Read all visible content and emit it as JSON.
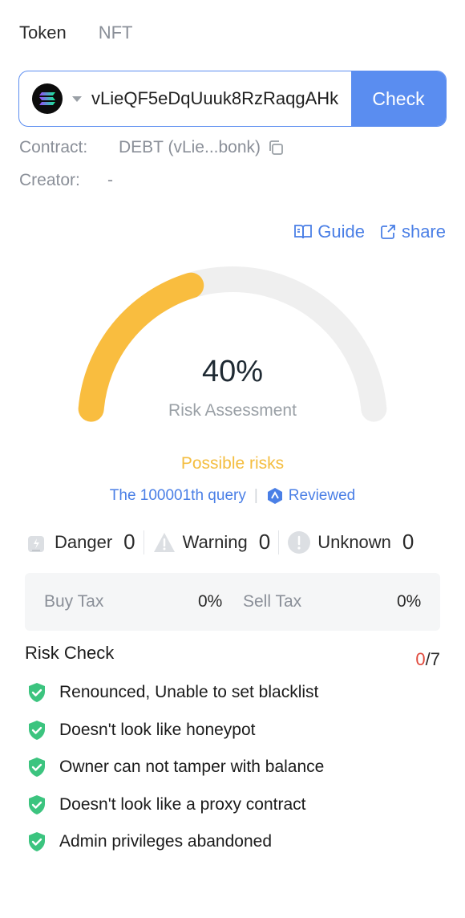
{
  "tabs": [
    {
      "label": "Token",
      "active": true
    },
    {
      "label": "NFT",
      "active": false
    }
  ],
  "search": {
    "chain_icon": "solana-logo",
    "address": "vLieQF5eDqUuuk8RzRaqgAHk",
    "check_label": "Check"
  },
  "contract": {
    "label": "Contract:",
    "value": "DEBT (vLie...bonk)",
    "copy_icon": "copy-icon"
  },
  "creator": {
    "label": "Creator:",
    "value": "-"
  },
  "links": {
    "guide": "Guide",
    "share": "share"
  },
  "gauge": {
    "percent_text": "40%",
    "fraction": 0.4,
    "label": "Risk Assessment",
    "status": "Possible risks",
    "fill_color": "#f9bd3f",
    "track_color": "#efefef"
  },
  "query": {
    "text": "The 100001th query",
    "reviewed": "Reviewed"
  },
  "stats": {
    "danger_label": "Danger",
    "danger_count": "0",
    "warning_label": "Warning",
    "warning_count": "0",
    "unknown_label": "Unknown",
    "unknown_count": "0"
  },
  "tax": {
    "buy_label": "Buy Tax",
    "buy_value": "0%",
    "sell_label": "Sell Tax",
    "sell_value": "0%"
  },
  "risk_check": {
    "title": "Risk Check",
    "failed": "0",
    "total": "/7",
    "items": [
      "Renounced, Unable to set blacklist",
      "Doesn't look like honeypot",
      "Owner can not tamper with balance",
      "Doesn't look like a proxy contract",
      "Admin privileges abandoned"
    ]
  },
  "colors": {
    "accent": "#5a8df0",
    "ok": "#3cc47f",
    "warn": "#f4bd3f",
    "bad": "#e0493c"
  }
}
